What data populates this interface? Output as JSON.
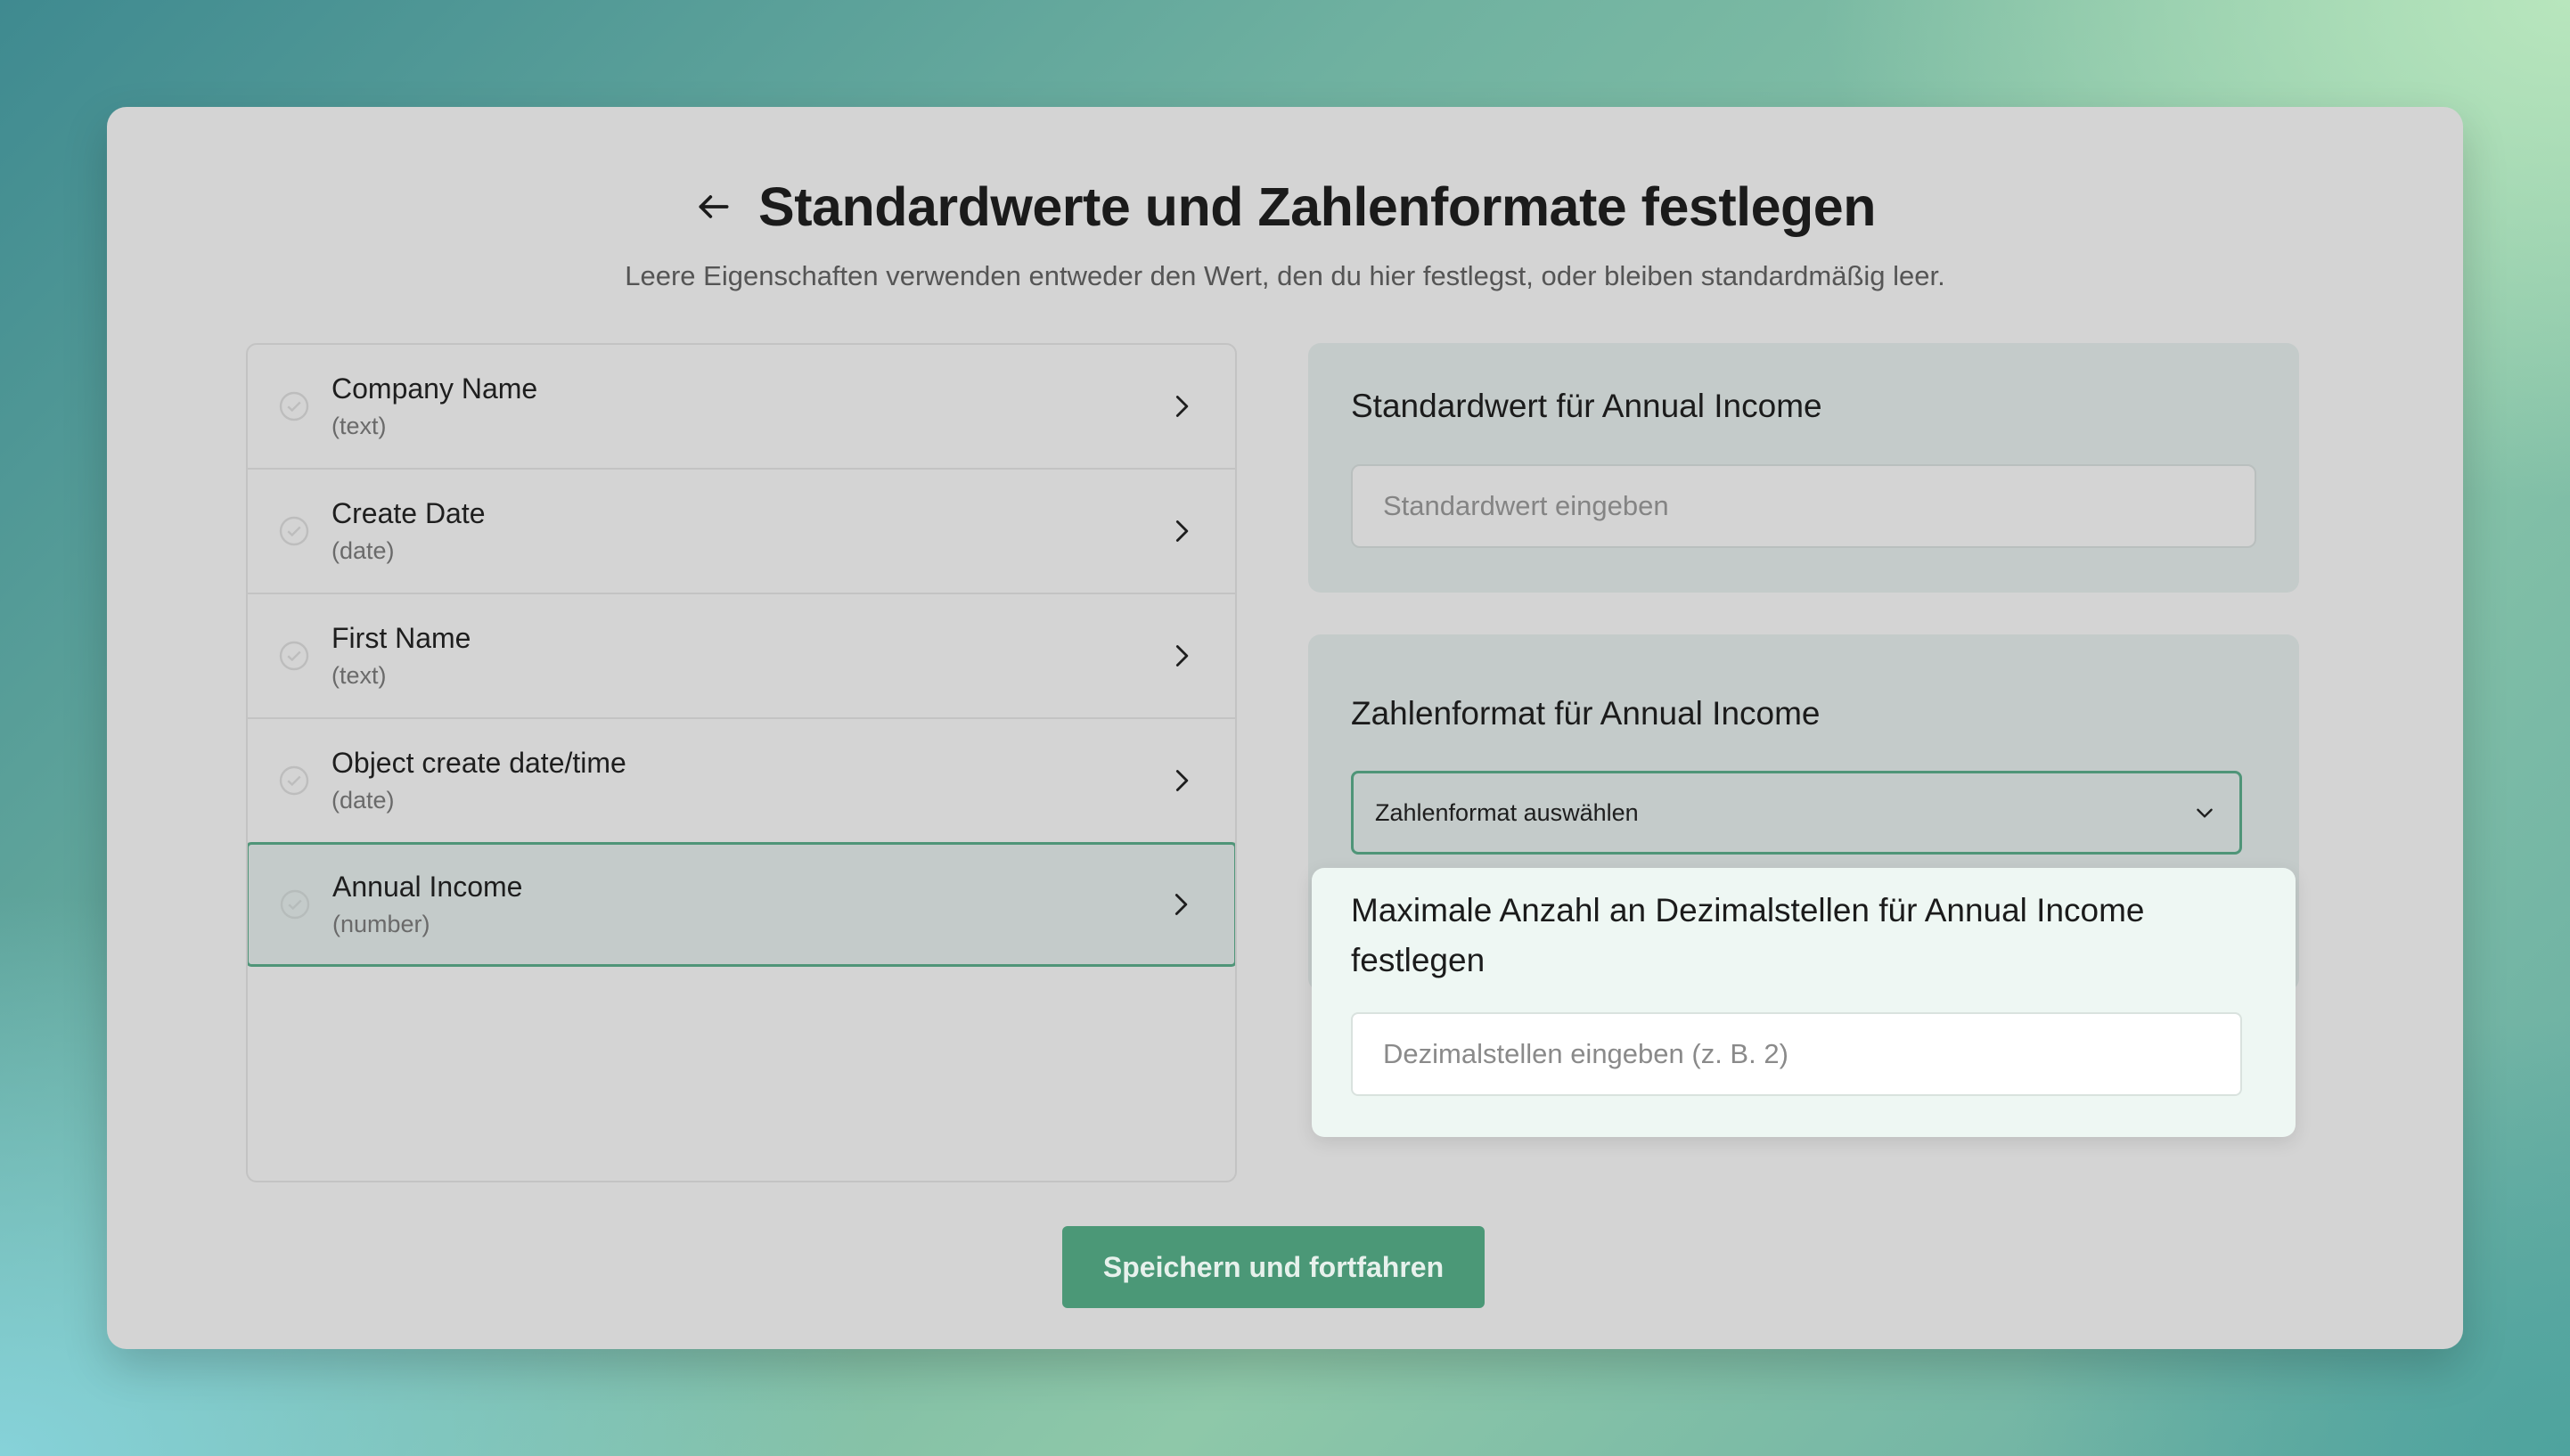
{
  "header": {
    "title": "Standardwerte und Zahlenformate festlegen",
    "subtitle": "Leere Eigenschaften verwenden entweder den Wert, den du hier festlegst, oder bleiben standardmäßig leer."
  },
  "properties": [
    {
      "name": "Company Name",
      "type": "(text)",
      "selected": false
    },
    {
      "name": "Create Date",
      "type": "(date)",
      "selected": false
    },
    {
      "name": "First Name",
      "type": "(text)",
      "selected": false
    },
    {
      "name": "Object create date/time",
      "type": "(date)",
      "selected": false
    },
    {
      "name": "Annual Income",
      "type": "(number)",
      "selected": true
    }
  ],
  "default_value_panel": {
    "title": "Standardwert für Annual Income",
    "placeholder": "Standardwert eingeben"
  },
  "number_format_panel": {
    "title": "Zahlenformat für Annual Income",
    "select_value": "Zahlenformat auswählen"
  },
  "decimals_popup": {
    "title": "Maximale Anzahl an Dezimalstellen für Annual Income festlegen",
    "placeholder": "Dezimalstellen eingeben (z. B. 2)"
  },
  "footer": {
    "save_label": "Speichern und fortfahren"
  },
  "colors": {
    "accent": "#4b9877",
    "card_bg": "#d4d4d4",
    "panel_bg": "#c4cbca",
    "popup_bg": "#eef7f3"
  }
}
